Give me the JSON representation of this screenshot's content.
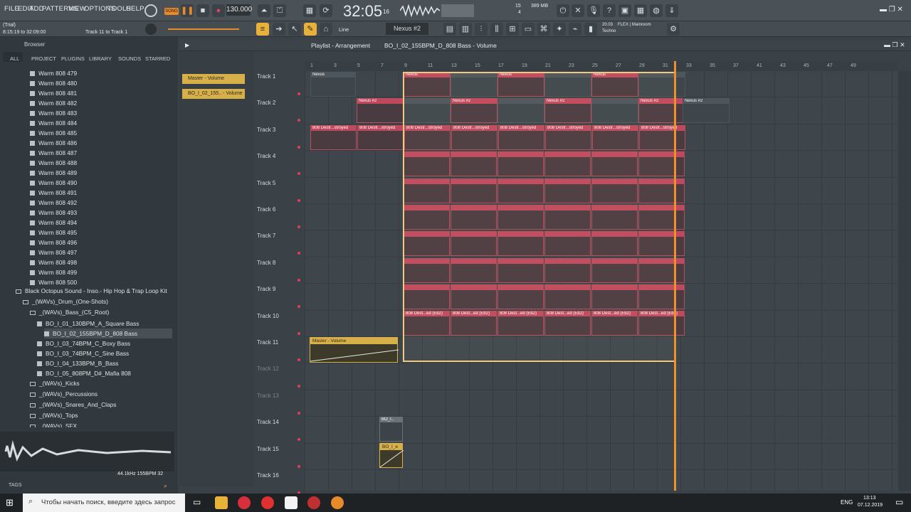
{
  "menu": [
    "FILE",
    "EDIT",
    "ADD",
    "PATTERNS",
    "VIEW",
    "OPTIONS",
    "TOOLS",
    "HELP"
  ],
  "song_mode": "SONG",
  "tempo": "130.000",
  "time": "32:05",
  "time_sub": "16",
  "hint": {
    "trial": "(Trial)",
    "range": "8:15:19 to 32:09:00",
    "target": "Track 11 to Track 1"
  },
  "snap": "Line",
  "pattern_name": "Nexus #2",
  "cpu": {
    "mem": "389 MB",
    "cpu": "15",
    "poly": "4"
  },
  "plugin_info": {
    "ver": "20.03",
    "name": "FLEX | Mainroom",
    "sub": "Techno"
  },
  "browser": {
    "label": "Browser",
    "tabs": [
      "ALL",
      "PROJECT",
      "PLUGINS",
      "LIBRARY",
      "SOUNDS",
      "STARRED"
    ],
    "items": [
      "Warm 808 479",
      "Warm 808 480",
      "Warm 808 481",
      "Warm 808 482",
      "Warm 808 483",
      "Warm 808 484",
      "Warm 808 485",
      "Warm 808 486",
      "Warm 808 487",
      "Warm 808 488",
      "Warm 808 489",
      "Warm 808 490",
      "Warm 808 491",
      "Warm 808 492",
      "Warm 808 493",
      "Warm 808 494",
      "Warm 808 495",
      "Warm 808 496",
      "Warm 808 497",
      "Warm 808 498",
      "Warm 808 499",
      "Warm 808 500"
    ],
    "pack": "Black Octopus Sound - Inso.- Hip Hop & Trap Loop Kit",
    "drum_folder": "_(WAVs)_Drum_(One-Shots)",
    "bass_folder": "_(WAVs)_Bass_(C5_Root)",
    "bass_files": [
      "BO_I_01_130BPM_A_Square Bass",
      "BO_I_02_155BPM_D_808 Bass",
      "BO_I_03_74BPM_C_Boxy Bass",
      "BO_I_03_74BPM_C_Sine Bass",
      "BO_I_04_133BPM_B_Bass",
      "BO_I_05_808PM_D#_Mafia 808"
    ],
    "folders": [
      "_(WAVs)_Kicks",
      "_(WAVs)_Percussions",
      "_(WAVs)_Snares_And_Claps",
      "_(WAVs)_Tops",
      "_(WAVs)_SFX"
    ],
    "preview_info": "44.1kHz 155BPM 32",
    "tags_label": "TAGS"
  },
  "playlist": {
    "title": "Playlist - Arrangement",
    "path": "BO_I_02_155BPM_D_808 Bass - Volume",
    "patterns": [
      "Master - Volume",
      "BO_I_02_155.. - Volume"
    ],
    "tracks": [
      "Track 1",
      "Track 2",
      "Track 3",
      "Track 4",
      "Track 5",
      "Track 6",
      "Track 7",
      "Track 8",
      "Track 9",
      "Track 10",
      "Track 11",
      "Track 12",
      "Track 13",
      "Track 14",
      "Track 15",
      "Track 16"
    ],
    "ruler": [
      "1",
      "3",
      "5",
      "7",
      "9",
      "11",
      "13",
      "15",
      "17",
      "19",
      "21",
      "23",
      "25",
      "27",
      "29",
      "31",
      "33",
      "35",
      "37",
      "41",
      "43",
      "45",
      "47",
      "49"
    ],
    "clip_nexus": "Nexus",
    "clip_nexus2": "Nexus #2",
    "clip_808": "808 Destr...stroyed",
    "clip_808b": "808 Dest...ed (Eb2)",
    "clip_auto": "Master - Volume",
    "clip_bo": "BO_I..",
    "clip_bo2": "BO_I_e"
  },
  "taskbar": {
    "search": "Чтобы начать поиск, введите здесь запрос",
    "lang": "ENG",
    "clock": "13:13",
    "date": "07.12.2019"
  }
}
